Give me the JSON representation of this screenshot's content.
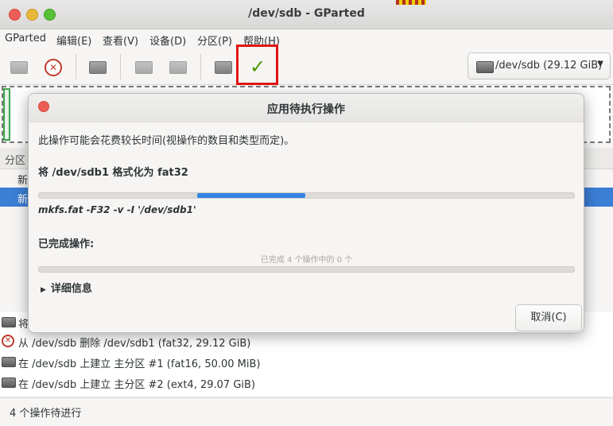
{
  "window": {
    "title": "/dev/sdb - GParted"
  },
  "menubar": {
    "items": [
      "GParted",
      "编辑(E)",
      "查看(V)",
      "设备(D)",
      "分区(P)",
      "帮助(H)"
    ]
  },
  "toolbar": {
    "buttons": [
      {
        "icon": "new-partition-icon",
        "enabled": false
      },
      {
        "icon": "delete-icon",
        "enabled": true
      },
      {
        "icon": "resize-move-icon",
        "enabled": true
      },
      {
        "icon": "copy-icon",
        "enabled": false
      },
      {
        "icon": "paste-icon",
        "enabled": false
      },
      {
        "icon": "undo-icon",
        "enabled": true
      },
      {
        "icon": "apply-icon",
        "enabled": true
      }
    ],
    "highlight_color": "#e41414"
  },
  "device_selector": {
    "label": "/dev/sdb (29.12 GiB)"
  },
  "partition_list": {
    "header": "分区",
    "rows": [
      "新",
      "新"
    ]
  },
  "pending_ops": {
    "items": [
      {
        "icon": "format-icon",
        "text": "将"
      },
      {
        "icon": "delete-icon",
        "text": "从 /dev/sdb 删除 /dev/sdb1 (fat32, 29.12 GiB)"
      },
      {
        "icon": "disk-icon",
        "text": "在 /dev/sdb 上建立 主分区 #1 (fat16, 50.00 MiB)"
      },
      {
        "icon": "disk-icon",
        "text": "在 /dev/sdb 上建立 主分区 #2 (ext4, 29.07 GiB)"
      }
    ]
  },
  "statusbar": {
    "text": "4 个操作待进行"
  },
  "dialog": {
    "title": "应用待执行操作",
    "info": "此操作可能会花费较长时间(视操作的数目和类型而定)。",
    "current_operation": "将 /dev/sdb1 格式化为 fat32",
    "command": "mkfs.fat -F32 -v -I '/dev/sdb1'",
    "completed_label": "已完成操作:",
    "completed_text": "已完成 4 个操作中的 0 个",
    "completed_progress": 0,
    "details_label": "详细信息",
    "cancel_label": "取消(C)",
    "accent_color": "#3584e4"
  }
}
